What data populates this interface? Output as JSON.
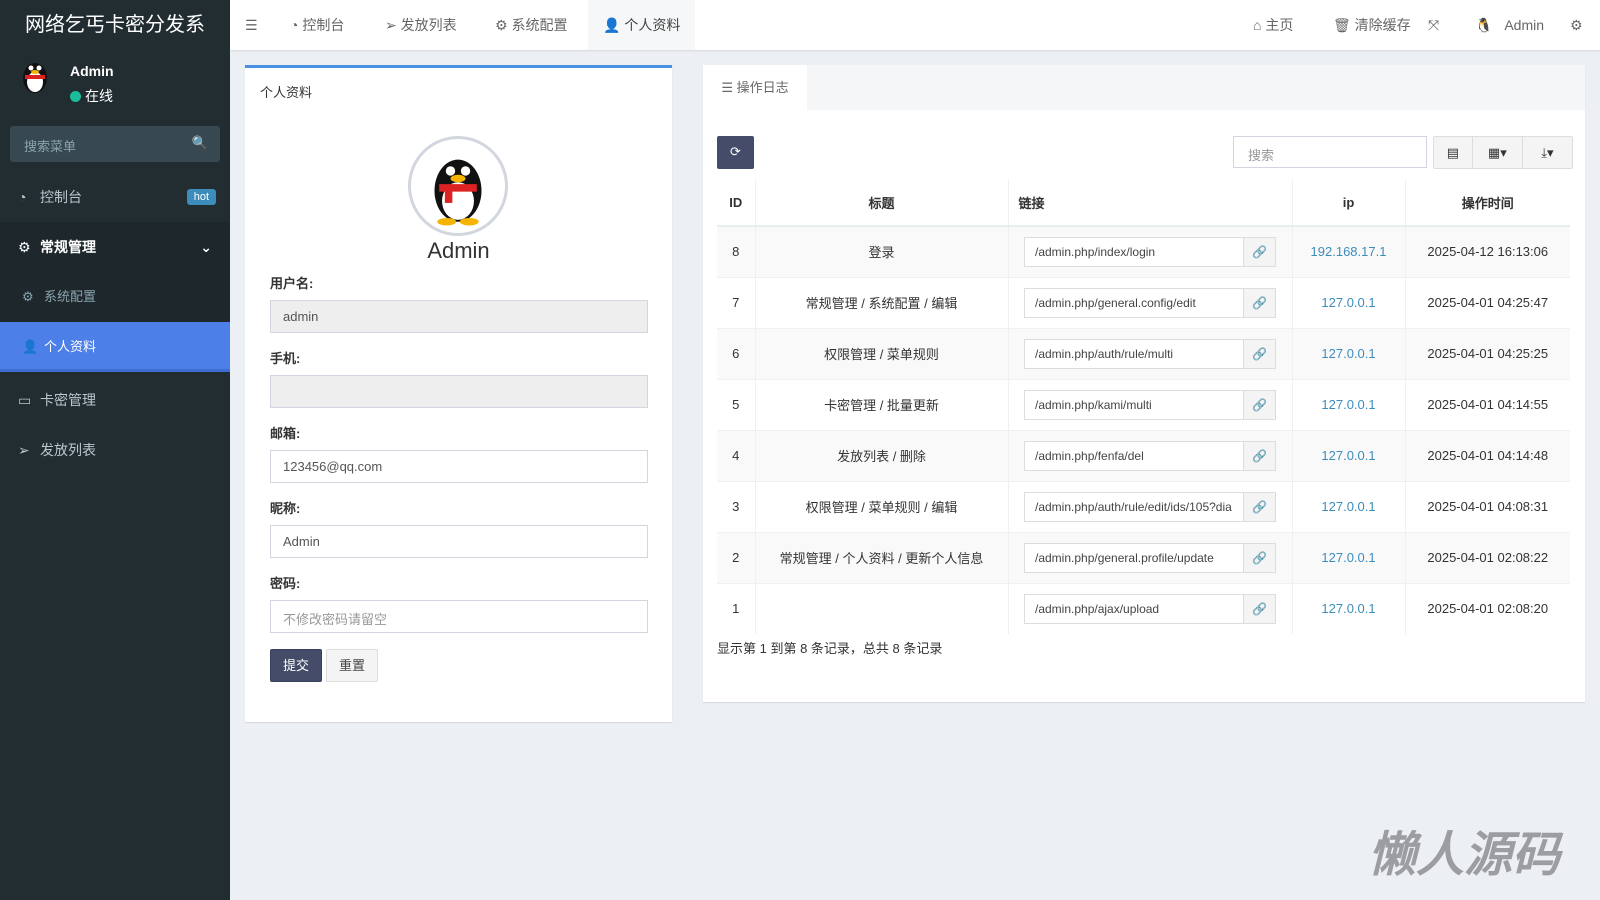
{
  "app": {
    "title": "网络乞丐卡密分发系"
  },
  "user": {
    "name": "Admin",
    "status": "在线"
  },
  "sidebar": {
    "search_placeholder": "搜索菜单",
    "items": [
      {
        "label": "控制台",
        "badge": "hot"
      },
      {
        "label": "常规管理"
      },
      {
        "label": "系统配置"
      },
      {
        "label": "个人资料"
      },
      {
        "label": "卡密管理"
      },
      {
        "label": "发放列表"
      }
    ]
  },
  "header": {
    "tabs": [
      "控制台",
      "发放列表",
      "系统配置",
      "个人资料"
    ],
    "right": {
      "home": "主页",
      "clear_cache": "清除缓存",
      "user": "Admin"
    }
  },
  "profile": {
    "title": "个人资料",
    "name": "Admin",
    "username_label": "用户名:",
    "username": "admin",
    "mobile_label": "手机:",
    "mobile": "",
    "email_label": "邮箱:",
    "email": "123456@qq.com",
    "nickname_label": "昵称:",
    "nickname": "Admin",
    "password_label": "密码:",
    "password_placeholder": "不修改密码请留空",
    "submit": "提交",
    "reset": "重置"
  },
  "log": {
    "tab": "操作日志",
    "search_placeholder": "搜索",
    "columns": [
      "ID",
      "标题",
      "链接",
      "ip",
      "操作时间"
    ],
    "rows": [
      {
        "id": "8",
        "title": "登录",
        "url": "/admin.php/index/login",
        "ip": "192.168.17.1",
        "time": "2025-04-12 16:13:06"
      },
      {
        "id": "7",
        "title": "常规管理 / 系统配置 / 编辑",
        "url": "/admin.php/general.config/edit",
        "ip": "127.0.0.1",
        "time": "2025-04-01 04:25:47"
      },
      {
        "id": "6",
        "title": "权限管理 / 菜单规则",
        "url": "/admin.php/auth/rule/multi",
        "ip": "127.0.0.1",
        "time": "2025-04-01 04:25:25"
      },
      {
        "id": "5",
        "title": "卡密管理 / 批量更新",
        "url": "/admin.php/kami/multi",
        "ip": "127.0.0.1",
        "time": "2025-04-01 04:14:55"
      },
      {
        "id": "4",
        "title": "发放列表 / 删除",
        "url": "/admin.php/fenfa/del",
        "ip": "127.0.0.1",
        "time": "2025-04-01 04:14:48"
      },
      {
        "id": "3",
        "title": "权限管理 / 菜单规则 / 编辑",
        "url": "/admin.php/auth/rule/edit/ids/105?dia",
        "ip": "127.0.0.1",
        "time": "2025-04-01 04:08:31"
      },
      {
        "id": "2",
        "title": "常规管理 / 个人资料 / 更新个人信息",
        "url": "/admin.php/general.profile/update",
        "ip": "127.0.0.1",
        "time": "2025-04-01 02:08:22"
      },
      {
        "id": "1",
        "title": "",
        "url": "/admin.php/ajax/upload",
        "ip": "127.0.0.1",
        "time": "2025-04-01 02:08:20"
      }
    ],
    "summary": "显示第 1 到第 8 条记录，总共 8 条记录"
  },
  "watermark": "懒人源码"
}
